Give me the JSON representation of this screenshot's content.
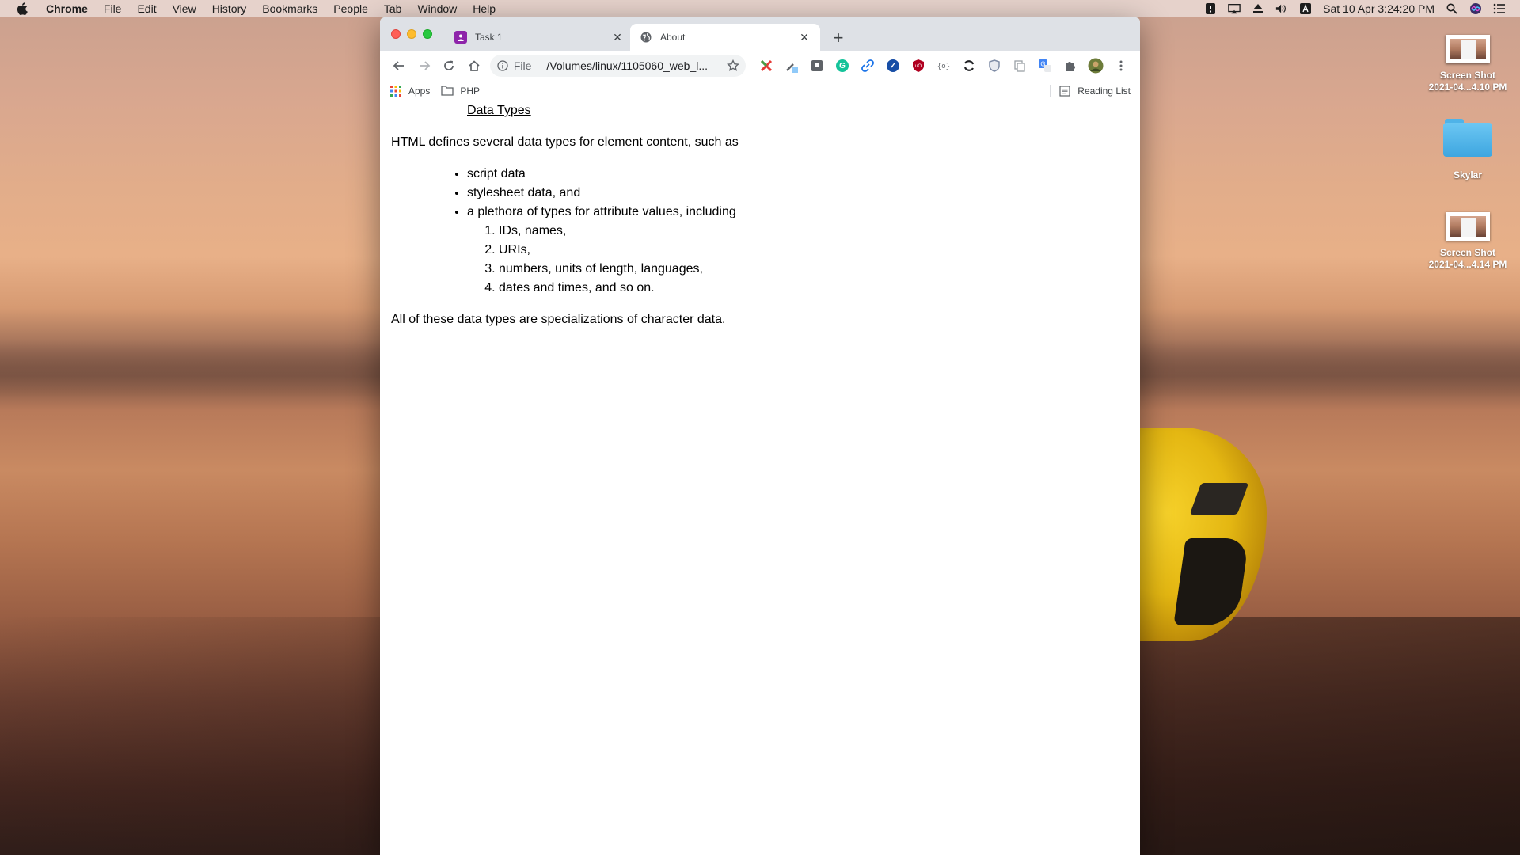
{
  "menubar": {
    "app": "Chrome",
    "items": [
      "File",
      "Edit",
      "View",
      "History",
      "Bookmarks",
      "People",
      "Tab",
      "Window",
      "Help"
    ],
    "clock": "Sat 10 Apr  3:24:20 PM"
  },
  "desktop": {
    "icons": [
      {
        "name": "screenshot-1",
        "line1": "Screen Shot",
        "line2": "2021-04...4.10 PM"
      },
      {
        "name": "folder",
        "line1": "Skylar",
        "line2": ""
      },
      {
        "name": "screenshot-2",
        "line1": "Screen Shot",
        "line2": "2021-04...4.14 PM"
      }
    ]
  },
  "browser": {
    "tabs": [
      {
        "title": "Task 1",
        "favicon": "classroom-icon",
        "favicon_color": "#8e24aa",
        "active": false
      },
      {
        "title": "About",
        "favicon": "globe-icon",
        "active": true
      }
    ],
    "omnibox": {
      "scheme": "File",
      "url": "/Volumes/linux/1105060_web_l..."
    },
    "extensions": [
      {
        "name": "x-extension-icon",
        "color": "#e53935"
      },
      {
        "name": "eyedropper-extension-icon",
        "color": "#5f6368"
      },
      {
        "name": "box-extension-icon",
        "color": "#5f6368"
      },
      {
        "name": "grammarly-extension-icon",
        "color": "#15c39a"
      },
      {
        "name": "link-extension-icon",
        "color": "#1a73e8"
      },
      {
        "name": "check-extension-icon",
        "color": "#174ea6"
      },
      {
        "name": "ublock-extension-icon",
        "color": "#b00020"
      },
      {
        "name": "json-extension-icon",
        "color": "#5f6368"
      },
      {
        "name": "refresh-extension-icon",
        "color": "#202124"
      },
      {
        "name": "shield-extension-icon",
        "color": "#7f8ca6"
      },
      {
        "name": "copy-extension-icon",
        "color": "#9aa0a6"
      },
      {
        "name": "translate-extension-icon",
        "color": "#4285f4"
      },
      {
        "name": "puzzle-extension-icon",
        "color": "#5f6368"
      }
    ],
    "bookmarks": {
      "apps": "Apps",
      "php": "PHP",
      "reading_list": "Reading List"
    }
  },
  "page": {
    "heading_link": "Data Types",
    "intro": "HTML defines several data types for element content, such as",
    "bullets": [
      "script data",
      "stylesheet data, and",
      "a plethora of types for attribute values, including"
    ],
    "numbered": [
      "IDs, names,",
      "URIs,",
      "numbers, units of length, languages,",
      "dates and times, and so on."
    ],
    "closing": "All of these data types are specializations of character data."
  }
}
